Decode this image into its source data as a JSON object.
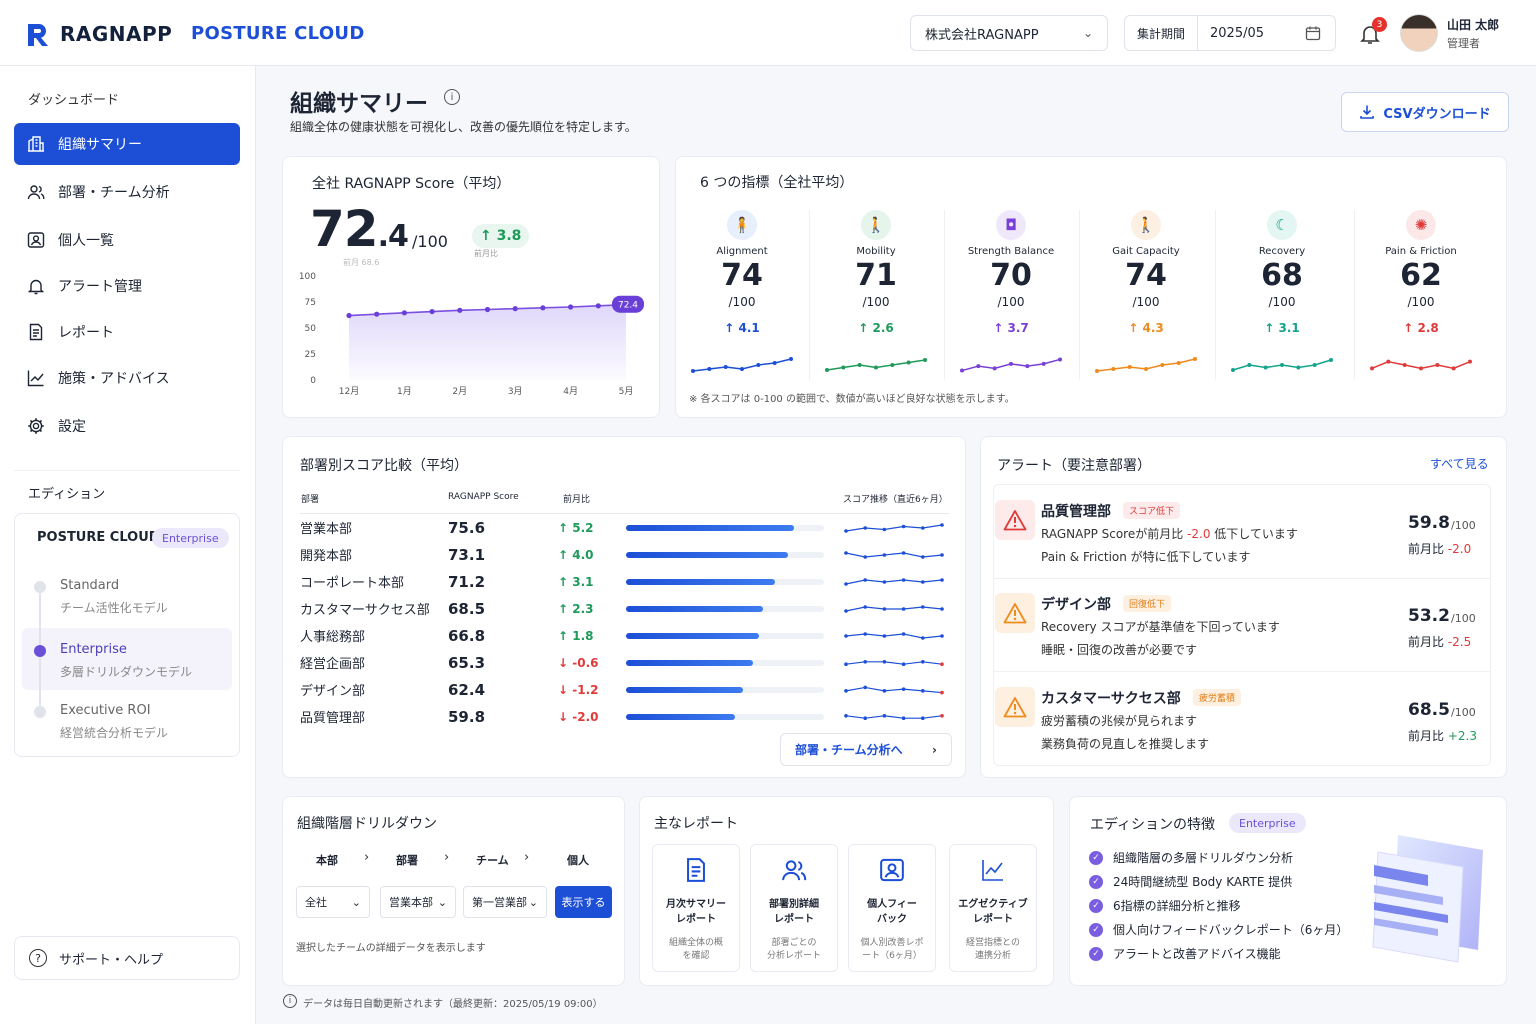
{
  "header": {
    "brand": "RAGNAPP",
    "product": "POSTURE CLOUD",
    "company": "株式会社RAGNAPP",
    "period_label": "集計期間",
    "period_value": "2025/05",
    "notifications": "3",
    "user_name": "山田 太郎",
    "user_role": "管理者"
  },
  "sidebar": {
    "dashboard": "ダッシュボード",
    "items": [
      {
        "label": "組織サマリー",
        "icon": "building-icon"
      },
      {
        "label": "部署・チーム分析",
        "icon": "users-icon"
      },
      {
        "label": "個人一覧",
        "icon": "person-icon"
      },
      {
        "label": "アラート管理",
        "icon": "bell-icon"
      },
      {
        "label": "レポート",
        "icon": "document-icon"
      },
      {
        "label": "施策・アドバイス",
        "icon": "trend-icon"
      },
      {
        "label": "設定",
        "icon": "gear-icon"
      }
    ],
    "edition_title": "エディション",
    "edition_name": "POSTURE CLOUD",
    "edition_badge": "Enterprise",
    "tiers": [
      {
        "name": "Standard",
        "sub": "チーム活性化モデル"
      },
      {
        "name": "Enterprise",
        "sub": "多層ドリルダウンモデル"
      },
      {
        "name": "Executive ROI",
        "sub": "経営統合分析モデル"
      }
    ],
    "help": "サポート・ヘルプ"
  },
  "page": {
    "title": "組織サマリー",
    "subtitle": "組織全体の健康状態を可視化し、改善の優先順位を特定します。",
    "csv": "CSVダウンロード"
  },
  "score_card": {
    "title": "全社 RAGNAPP Score（平均）",
    "int": "72",
    "dec": ".4",
    "denom": "/100",
    "delta": "↑ 3.8",
    "delta_label": "前月比",
    "prev_label": "前月 68.6",
    "tag": "72.4"
  },
  "chart_data": {
    "type": "line",
    "x": [
      "12月",
      "1月",
      "2月",
      "3月",
      "4月",
      "5月"
    ],
    "yticks": [
      "100",
      "75",
      "50",
      "25",
      "0"
    ],
    "ylim": [
      0,
      100
    ],
    "values": [
      62.0,
      64.6,
      67.0,
      68.6,
      70.2,
      72.4
    ],
    "point_tag": "72.4"
  },
  "metrics": {
    "title": "6 つの指標（全社平均）",
    "note": "※ 各スコアは 0-100 の範囲で、数値が高いほど良好な状態を示します。",
    "den": "/100",
    "items": [
      {
        "name": "Alignment",
        "value": "74",
        "delta": "↑ 4.1",
        "color": "#1c4fd6",
        "bg": "#e7eefc",
        "icon": "alignment-icon",
        "glyph": "🧍",
        "trend": [
          68,
          69,
          70,
          69,
          71,
          72,
          74
        ]
      },
      {
        "name": "Mobility",
        "value": "71",
        "delta": "↑ 2.6",
        "color": "#1e9a5a",
        "bg": "#e5f5ec",
        "icon": "mobility-icon",
        "glyph": "🚶",
        "trend": [
          67,
          68,
          69,
          68,
          69,
          70,
          71
        ]
      },
      {
        "name": "Strength Balance",
        "value": "70",
        "delta": "↑ 3.7",
        "color": "#7a3fd6",
        "bg": "#efe8fb",
        "icon": "dumbbell-icon",
        "glyph": "◘",
        "trend": [
          65,
          67,
          66,
          68,
          67,
          68,
          70
        ]
      },
      {
        "name": "Gait Capacity",
        "value": "74",
        "delta": "↑ 4.3",
        "color": "#f08a1c",
        "bg": "#fdf0e2",
        "icon": "gait-icon",
        "glyph": "🚶",
        "trend": [
          68,
          69,
          70,
          69,
          71,
          72,
          74
        ]
      },
      {
        "name": "Recovery",
        "value": "68",
        "delta": "↑ 3.1",
        "color": "#14a38b",
        "bg": "#e3f6f2",
        "icon": "moon-icon",
        "glyph": "☾",
        "trend": [
          64,
          66,
          65,
          66,
          65,
          66,
          68
        ]
      },
      {
        "name": "Pain & Friction",
        "value": "62",
        "delta": "↑ 2.8",
        "color": "#e03a3a",
        "bg": "#fce8e8",
        "icon": "pain-icon",
        "glyph": "✺",
        "trend": [
          60,
          62,
          61,
          60,
          61,
          60,
          62
        ]
      }
    ]
  },
  "dept": {
    "title": "部署別スコア比較（平均）",
    "cols": [
      "部署",
      "RAGNAPP Score",
      "前月比",
      "スコア推移（直近6ヶ月）"
    ],
    "rows": [
      {
        "name": "営業本部",
        "score": "75.6",
        "delta": "↑ 5.2",
        "up": true,
        "pct": 0.85,
        "trend": [
          70,
          72,
          71,
          73,
          72,
          74
        ]
      },
      {
        "name": "開発本部",
        "score": "73.1",
        "delta": "↑ 4.0",
        "up": true,
        "pct": 0.82,
        "trend": [
          72,
          70,
          71,
          72,
          70,
          71
        ]
      },
      {
        "name": "コーポレート本部",
        "score": "71.2",
        "delta": "↑ 3.1",
        "up": true,
        "pct": 0.75,
        "trend": [
          70,
          72,
          71,
          72,
          71,
          72
        ]
      },
      {
        "name": "カスタマーサクセス部",
        "score": "68.5",
        "delta": "↑ 2.3",
        "up": true,
        "pct": 0.69,
        "trend": [
          69,
          71,
          70,
          70,
          71,
          70
        ]
      },
      {
        "name": "人事総務部",
        "score": "66.8",
        "delta": "↑ 1.8",
        "up": true,
        "pct": 0.67,
        "trend": [
          70,
          71,
          70,
          71,
          69,
          70
        ]
      },
      {
        "name": "経営企画部",
        "score": "65.3",
        "delta": "↓ -0.6",
        "up": false,
        "pct": 0.64,
        "trend": [
          70,
          71,
          71,
          70,
          71,
          70
        ]
      },
      {
        "name": "デザイン部",
        "score": "62.4",
        "delta": "↓ -1.2",
        "up": false,
        "pct": 0.59,
        "trend": [
          70,
          72,
          70,
          71,
          70,
          69
        ]
      },
      {
        "name": "品質管理部",
        "score": "59.8",
        "delta": "↓ -2.0",
        "up": false,
        "pct": 0.55,
        "trend": [
          71,
          70,
          71,
          70,
          70,
          71
        ]
      }
    ],
    "link": "部署・チーム分析へ"
  },
  "alerts": {
    "title": "アラート（要注意部署）",
    "all": "すべて見る",
    "items": [
      {
        "name": "品質管理部",
        "tag": "スコア低下",
        "tagc": "#e03a3a",
        "tagbg": "#fdeaea",
        "icbg": "#fdeaea",
        "icc": "#e03a3a",
        "l1a": "RAGNAPP Scoreが前月比 ",
        "l1b": "-2.0",
        "l1c": " 低下しています",
        "l2": "Pain & Friction が特に低下しています",
        "score": "59.8",
        "den": "/100",
        "dlabel": "前月比 ",
        "delta": "-2.0",
        "dc": "#e03a3a"
      },
      {
        "name": "デザイン部",
        "tag": "回復低下",
        "tagc": "#e07b14",
        "tagbg": "#fdf0e0",
        "icbg": "#fdf0e0",
        "icc": "#f08a1c",
        "l1a": "Recovery スコアが基準値を下回っています",
        "l1b": "",
        "l1c": "",
        "l2": "睡眠・回復の改善が必要です",
        "score": "53.2",
        "den": "/100",
        "dlabel": "前月比 ",
        "delta": "-2.5",
        "dc": "#e03a3a"
      },
      {
        "name": "カスタマーサクセス部",
        "tag": "疲労蓄積",
        "tagc": "#e07b14",
        "tagbg": "#fdf0e0",
        "icbg": "#fdf0e0",
        "icc": "#f08a1c",
        "l1a": "疲労蓄積の兆候が見られます",
        "l1b": "",
        "l1c": "",
        "l2": "業務負荷の見直しを推奨します",
        "score": "68.5",
        "den": "/100",
        "dlabel": "前月比 ",
        "delta": "+2.3",
        "dc": "#1e9a5a"
      }
    ]
  },
  "drill": {
    "title": "組織階層ドリルダウン",
    "levels": [
      "本部",
      "部署",
      "チーム",
      "個人"
    ],
    "selects": [
      "全社",
      "営業本部",
      "第一営業部"
    ],
    "button": "表示する",
    "note": "選択したチームの詳細データを表示します"
  },
  "reports": {
    "title": "主なレポート",
    "items": [
      {
        "t1": "月次サマリー",
        "t2": "レポート",
        "s1": "組織全体の概",
        "s2": "を確認",
        "icon": "document-icon"
      },
      {
        "t1": "部署別詳細",
        "t2": "レポート",
        "s1": "部署ごとの",
        "s2": "分析レポート",
        "icon": "users-icon"
      },
      {
        "t1": "個人フィー",
        "t2": "バック",
        "s1": "個人別改善レポ",
        "s2": "ート（6ヶ月）",
        "icon": "person-icon"
      },
      {
        "t1": "エグゼクティブ",
        "t2": "レポート",
        "s1": "経営指標との",
        "s2": "連携分析",
        "icon": "chart-icon"
      }
    ]
  },
  "features": {
    "title": "エディションの特徴",
    "badge": "Enterprise",
    "items": [
      "組織階層の多層ドリルダウン分析",
      "24時間継続型 Body KARTE 提供",
      "6指標の詳細分析と推移",
      "個人向けフィードバックレポート（6ヶ月）",
      "アラートと改善アドバイス機能"
    ]
  },
  "footer": "データは毎日自動更新されます（最終更新：2025/05/19 09:00）"
}
